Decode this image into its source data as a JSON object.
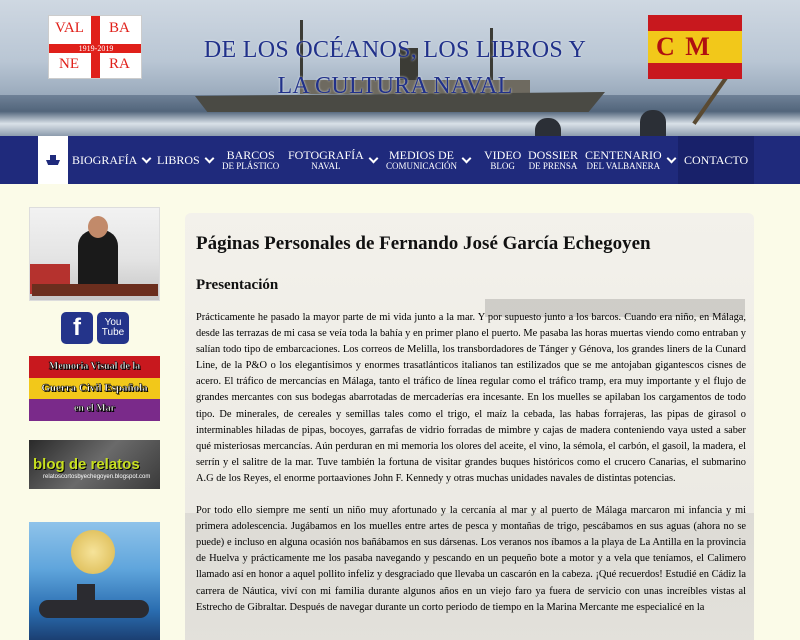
{
  "header": {
    "logo_left": {
      "tl": "VAL",
      "tr": "BA",
      "bl": "NE",
      "br": "RA",
      "years": "1919-2019"
    },
    "title_line1": "DE LOS OCÉANOS, LOS LIBROS Y",
    "title_line2": "LA CULTURA NAVAL",
    "logo_right": {
      "text": "C M"
    }
  },
  "nav": {
    "items": [
      {
        "label": "BIOGRAFÍA",
        "sub": ""
      },
      {
        "label": "LIBROS",
        "sub": ""
      },
      {
        "label": "BARCOS",
        "sub": "DE PLÁSTICO"
      },
      {
        "label": "FOTOGRAFÍA",
        "sub": "NAVAL"
      },
      {
        "label": "MEDIOS DE",
        "sub": "COMUNICACIÓN"
      },
      {
        "label": "VIDEO",
        "sub": "BLOG"
      },
      {
        "label": "DOSSIER",
        "sub": "DE PRENSA"
      },
      {
        "label": "CENTENARIO",
        "sub": "DEL VALBANERA"
      },
      {
        "label": "CONTACTO",
        "sub": ""
      }
    ]
  },
  "sidebar": {
    "facebook": "f",
    "youtube_l1": "You",
    "youtube_l2": "Tube",
    "memoria": {
      "l1": "Memoria Visual de la",
      "l2": "Guerra Civil Española",
      "l3": "en el Mar"
    },
    "blog": {
      "title": "blog de relatos",
      "url": "relatoscortosbyechegoyen.blogspot.com"
    }
  },
  "main": {
    "title": "Páginas Personales de Fernando José García Echegoyen",
    "section": "Presentación",
    "p1": "Prácticamente he pasado la mayor parte de mi vida junto a la mar. Y por supuesto junto a los barcos. Cuando era niño, en Málaga, desde las terrazas de mi casa se veía toda la bahía y en primer plano el puerto. Me pasaba las horas muertas viendo como entraban y salían todo tipo de embarcaciones. Los correos de Melilla, los transbordadores de Tánger y Génova, los grandes liners de la Cunard Line, de la P&O o los elegantísimos y enormes trasatlánticos italianos tan estilizados que se me antojaban gigantescos cisnes de acero. El tráfico de mercancías en Málaga, tanto el tráfico de línea regular como el tráfico tramp, era muy importante y el flujo de grandes mercantes con sus bodegas abarrotadas de mercaderías era incesante. En los muelles se apilaban los cargamentos de todo tipo. De minerales, de cereales y semillas tales como el trigo, el maíz la cebada, las habas forrajeras, las pipas de girasol o interminables hiladas de pipas, bocoyes, garrafas de vidrio forradas de mimbre y cajas de madera conteniendo vaya usted a saber qué misteriosas mercancías. Aún perduran en mi memoria los olores del aceite, el vino, la sémola, el carbón, el gasoil, la madera, el serrín y el salitre de la mar. Tuve también la fortuna de visitar grandes buques históricos como el crucero Canarias, el submarino A.G de los Reyes, el enorme portaaviones John F. Kennedy y otras muchas unidades navales de distintas potencias.",
    "p2": "Por todo ello siempre me sentí un niño muy afortunado y la cercanía al mar y al puerto de Málaga marcaron mi infancia y mi primera adolescencia. Jugábamos en los muelles entre artes de pesca y montañas de trigo, pescábamos en sus aguas (ahora no se puede) e incluso en alguna ocasión nos bañábamos en sus dársenas. Los veranos nos íbamos a la playa de La Antilla en la provincia de Huelva y prácticamente me los pasaba navegando y pescando en un pequeño bote a motor y a vela que teníamos, el Calimero llamado así en honor a aquel pollito infeliz y desgraciado que llevaba un cascarón en la cabeza. ¡Qué recuerdos! Estudié en Cádiz la carrera de Náutica, viví con mi familia durante algunos años en un viejo faro ya fuera de servicio con unas increíbles vistas al Estrecho de Gibraltar. Después de navegar durante un corto periodo de tiempo en la Marina Mercante me especialicé en la"
  }
}
